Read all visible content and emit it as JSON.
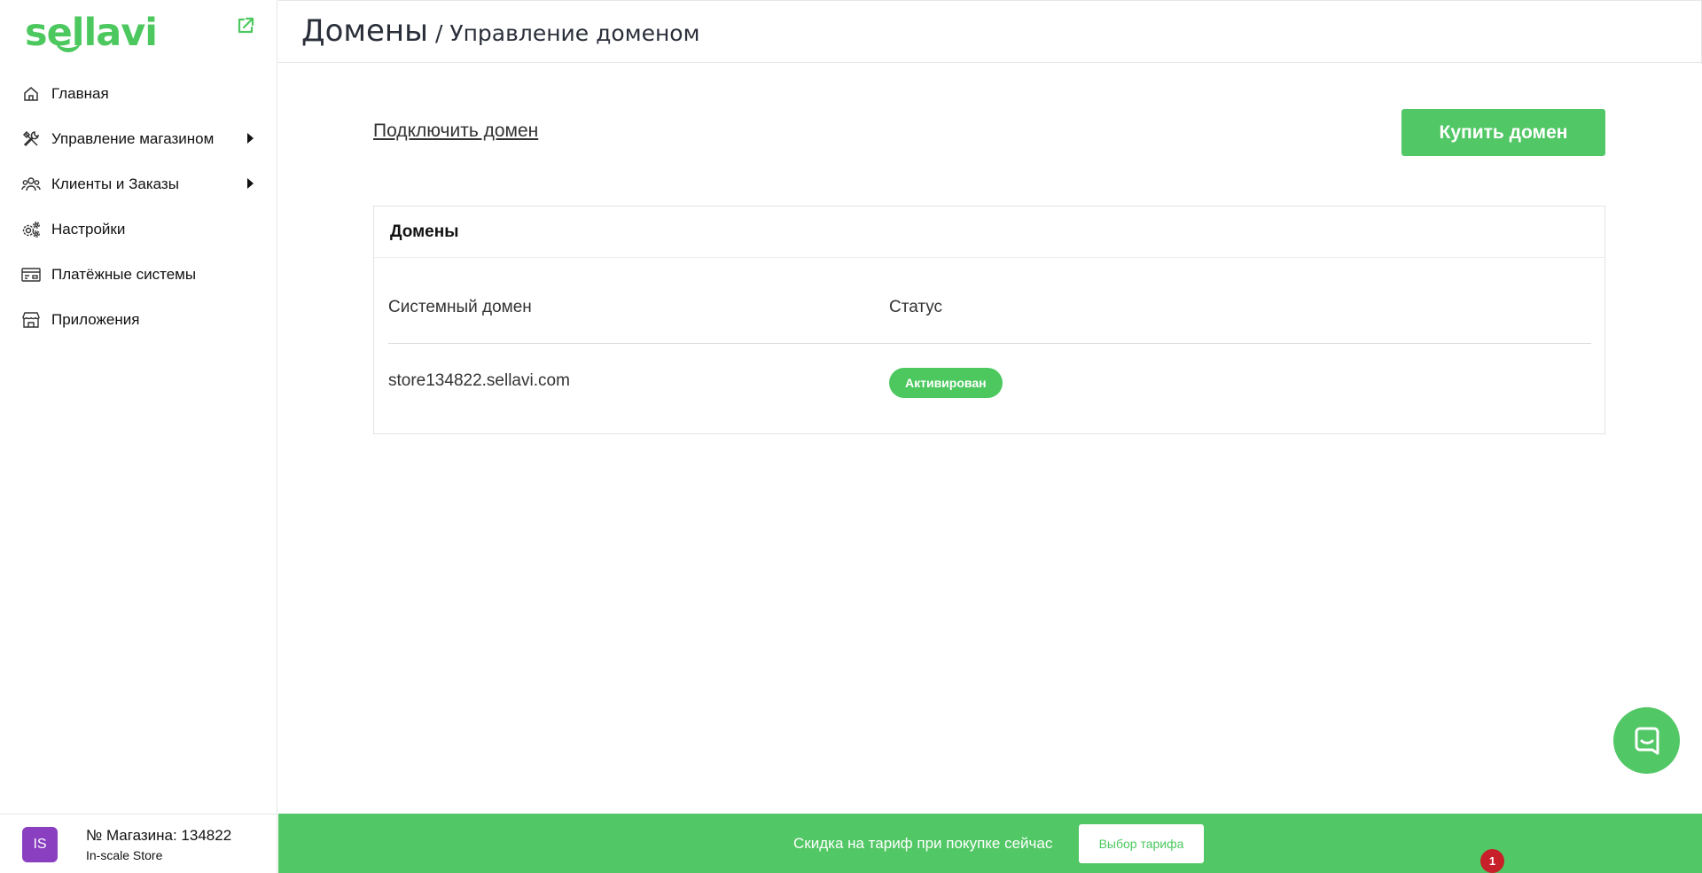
{
  "brand": {
    "logo_text": "sellavi",
    "accent": "#52c765"
  },
  "sidebar": {
    "items": [
      {
        "label": "Главная",
        "icon": "home-icon",
        "has_submenu": false
      },
      {
        "label": "Управление магазином",
        "icon": "tools-icon",
        "has_submenu": true
      },
      {
        "label": "Клиенты и Заказы",
        "icon": "users-icon",
        "has_submenu": true
      },
      {
        "label": "Настройки",
        "icon": "gears-icon",
        "has_submenu": false
      },
      {
        "label": "Платёжные системы",
        "icon": "payment-card-icon",
        "has_submenu": false
      },
      {
        "label": "Приложения",
        "icon": "store-icon",
        "has_submenu": false
      }
    ]
  },
  "store": {
    "avatar_initials": "IS",
    "number_label": "№ Магазина: 134822",
    "name": "In-scale Store",
    "avatar_color": "#8a3fc1"
  },
  "header": {
    "title": "Домены",
    "separator": " / ",
    "subtitle": "Управление доменом"
  },
  "main": {
    "connect_link": "Подключить домен",
    "buy_button": "Купить домен",
    "domains_card": {
      "title": "Домены",
      "columns": [
        "Системный домен",
        "Статус"
      ],
      "rows": [
        {
          "domain": "store134822.sellavi.com",
          "status": "Активирован",
          "status_color": "#4cc85f"
        }
      ]
    }
  },
  "promo": {
    "text": "Скидка на тариф при покупке сейчас",
    "button": "Выбор тарифа"
  },
  "notification": {
    "count": "1",
    "color": "#c8202a"
  }
}
